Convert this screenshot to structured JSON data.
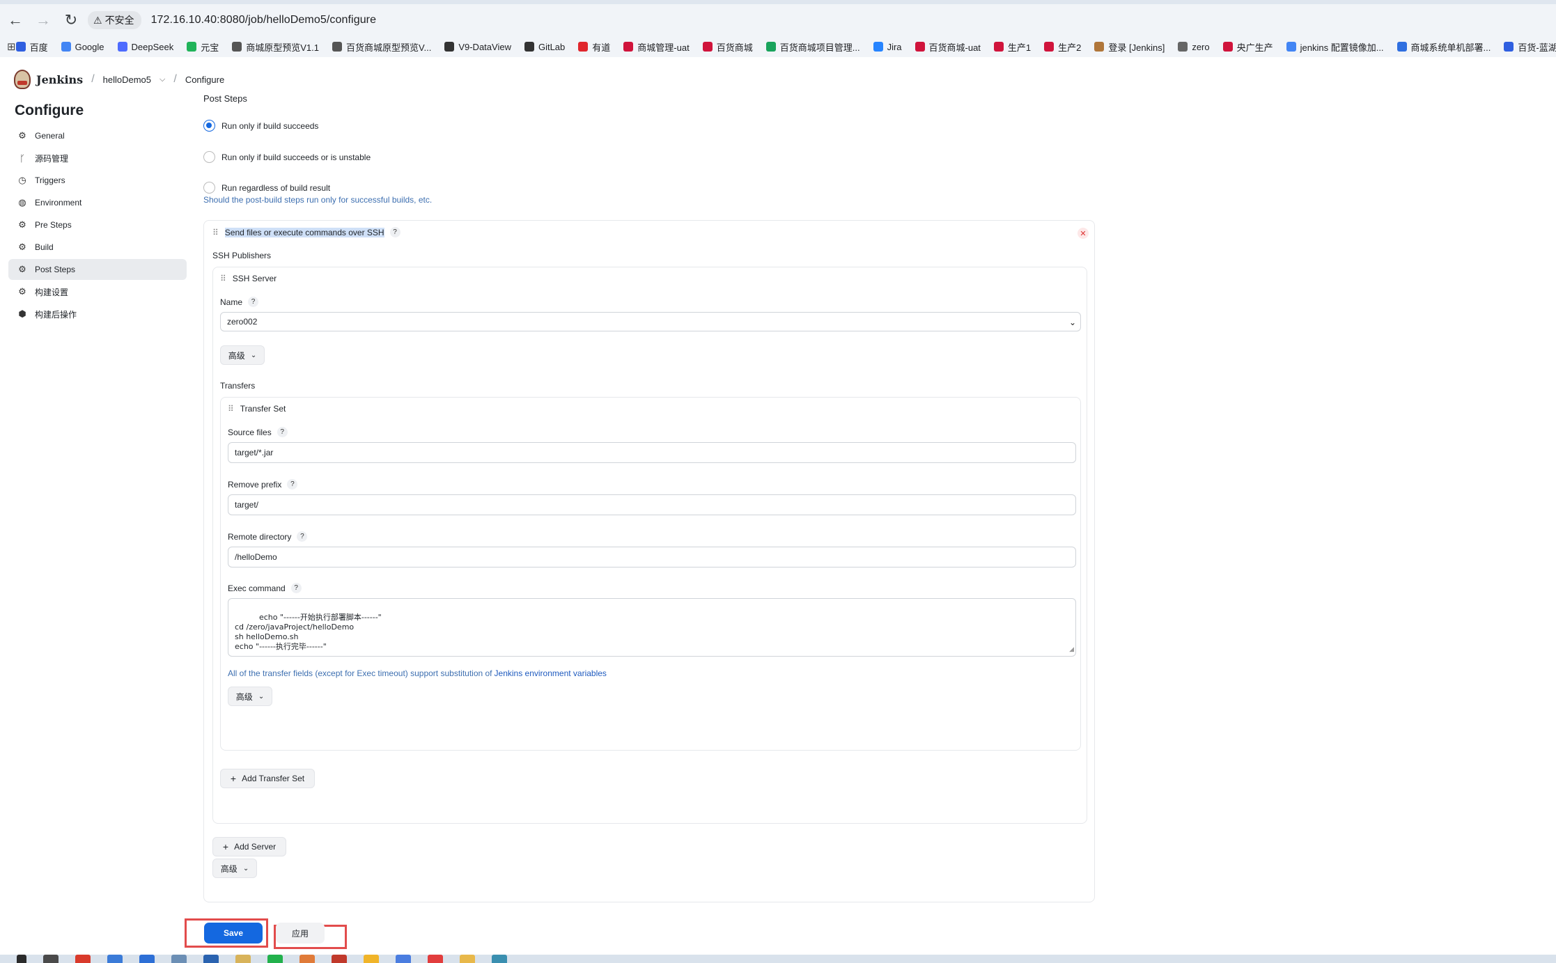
{
  "browser": {
    "insecure_label": "不安全",
    "url": "172.16.10.40:8080/job/helloDemo5/configure",
    "bookmarks": [
      {
        "label": "百度",
        "color": "#2f5fe0"
      },
      {
        "label": "Google",
        "color": "#4285f4"
      },
      {
        "label": "DeepSeek",
        "color": "#4d6bfe"
      },
      {
        "label": "元宝",
        "color": "#21b35a"
      },
      {
        "label": "商城原型预览V1.1",
        "color": "#555555"
      },
      {
        "label": "百货商城原型预览V...",
        "color": "#555555"
      },
      {
        "label": "V9-DataView",
        "color": "#333333"
      },
      {
        "label": "GitLab",
        "color": "#333333"
      },
      {
        "label": "有道",
        "color": "#e0262d"
      },
      {
        "label": "商城管理-uat",
        "color": "#d0143c"
      },
      {
        "label": "百货商城",
        "color": "#d0143c"
      },
      {
        "label": "百货商城项目管理...",
        "color": "#19a35c"
      },
      {
        "label": "Jira",
        "color": "#2684ff"
      },
      {
        "label": "百货商城-uat",
        "color": "#d0143c"
      },
      {
        "label": "生产1",
        "color": "#d0143c"
      },
      {
        "label": "生产2",
        "color": "#d0143c"
      },
      {
        "label": "登录 [Jenkins]",
        "color": "#b0763a"
      },
      {
        "label": "zero",
        "color": "#666666"
      },
      {
        "label": "央广生产",
        "color": "#d0143c"
      },
      {
        "label": "jenkins 配置镜像加...",
        "color": "#4285f4"
      },
      {
        "label": "商城系统单机部署...",
        "color": "#2f6fe0"
      },
      {
        "label": "百货-蓝湖",
        "color": "#2f5fe0"
      }
    ]
  },
  "header": {
    "app_name": "Jenkins",
    "breadcrumb_job": "helloDemo5",
    "breadcrumb_page": "Configure"
  },
  "sidebar": {
    "title": "Configure",
    "items": [
      {
        "label": "General",
        "icon": "gear-icon"
      },
      {
        "label": "源码管理",
        "icon": "branch-icon"
      },
      {
        "label": "Triggers",
        "icon": "clock-icon"
      },
      {
        "label": "Environment",
        "icon": "globe-icon"
      },
      {
        "label": "Pre Steps",
        "icon": "gear-icon"
      },
      {
        "label": "Build",
        "icon": "gear-icon"
      },
      {
        "label": "Post Steps",
        "icon": "gear-icon",
        "active": true
      },
      {
        "label": "构建设置",
        "icon": "gear-icon"
      },
      {
        "label": "构建后操作",
        "icon": "cube-icon"
      }
    ]
  },
  "post_steps": {
    "title": "Post Steps",
    "options": [
      {
        "label": "Run only if build succeeds",
        "checked": true
      },
      {
        "label": "Run only if build succeeds or is unstable",
        "checked": false
      },
      {
        "label": "Run regardless of build result",
        "checked": false
      }
    ],
    "hint": "Should the post-build steps run only for successful builds, etc."
  },
  "ssh_step": {
    "title": "Send files or execute commands over SSH",
    "publishers_label": "SSH Publishers",
    "server_title": "SSH Server",
    "name_label": "Name",
    "name_value": "zero002",
    "advanced_label": "高级",
    "transfers_label": "Transfers",
    "transfer_set_title": "Transfer Set",
    "source_files_label": "Source files",
    "source_files_value": "target/*.jar",
    "remove_prefix_label": "Remove prefix",
    "remove_prefix_value": "target/",
    "remote_dir_label": "Remote directory",
    "remote_dir_value": "/helloDemo",
    "exec_label": "Exec command",
    "exec_value": "echo \"------开始执行部署脚本------\"\ncd /zero/javaProject/helloDemo\nsh helloDemo.sh\necho \"------执行完毕------\"",
    "env_note_prefix": "All of the transfer fields (except for Exec timeout) support substitution of ",
    "env_note_link": "Jenkins environment variables",
    "transfer_advanced_label": "高级",
    "add_transfer_set_label": "Add Transfer Set",
    "add_server_label": "Add Server",
    "step_advanced_label": "高级"
  },
  "footer": {
    "save_label": "Save",
    "apply_label": "应用"
  }
}
